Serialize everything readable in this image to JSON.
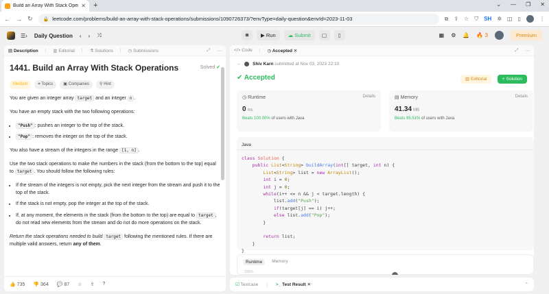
{
  "browser": {
    "tab_title": "Build an Array With Stack Opera",
    "url": "leetcode.com/problems/build-an-array-with-stack-operations/submissions/1090726373/?envType=daily-question&envId=2023-11-03",
    "profile": "SH"
  },
  "nav": {
    "daily": "Daily Question",
    "run": "Run",
    "submit": "Submit",
    "streak": "3",
    "premium": "Premium"
  },
  "left": {
    "tabs": [
      "Description",
      "Editorial",
      "Solutions",
      "Submissions"
    ],
    "title": "1441. Build an Array With Stack Operations",
    "solved": "Solved",
    "chips": [
      "Medium",
      "Topics",
      "Companies",
      "Hint"
    ],
    "p1_a": "You are given an integer array ",
    "p1_code1": "target",
    "p1_b": " and an integer ",
    "p1_code2": "n",
    "p1_c": ".",
    "p2": "You have an empty stack with the two following operations:",
    "op1_code": "\"Push\"",
    "op1_text": ": pushes an integer to the top of the stack.",
    "op2_code": "\"Pop\"",
    "op2_text": ": removes the integer on the top of the stack.",
    "p3_a": "You also have a stream of the integers in the range ",
    "p3_code": "[1, n]",
    "p3_b": ".",
    "p4_a": "Use the two stack operations to make the numbers in the stack (from the bottom to the top) equal to ",
    "p4_code": "target",
    "p4_b": ". You should follow the following rules:",
    "rule1": "If the stream of the integers is not empty, pick the next integer from the stream and push it to the top of the stack.",
    "rule2": "If the stack is not empty, pop the integer at the top of the stack.",
    "rule3_a": "If, at any moment, the elements in the stack (from the bottom to the top) are equal to ",
    "rule3_code": "target",
    "rule3_b": ", do not read new elements from the stream and do not do more operations on the stack.",
    "p5_a": "Return the stack operations needed to build ",
    "p5_code": "target",
    "p5_b": " following the mentioned rules. If there are multiple valid answers, return ",
    "p5_bold": "any of them",
    "p5_c": ".",
    "likes": "735",
    "dislikes": "364",
    "comments": "87"
  },
  "right": {
    "tabs": [
      "Code",
      "Accepted"
    ],
    "author": "Shiv Karn",
    "submitted": "submitted at Nov 03, 2023 22:10",
    "status": "Accepted",
    "editorial": "Editorial",
    "solution": "+ Solution",
    "runtime": {
      "label": "Runtime",
      "details": "Details",
      "value": "0",
      "unit": "ms",
      "beats_pct": "Beats 100.00%",
      "beats_rest": " of users with Java"
    },
    "memory": {
      "label": "Memory",
      "details": "Details",
      "value": "41.34",
      "unit": "MB",
      "beats_pct": "Beats 95.51%",
      "beats_rest": " of users with Java"
    },
    "language": "Java",
    "chart_tabs": [
      "Runtime",
      "Memory"
    ],
    "chart_pct": "100%"
  },
  "bottom": {
    "testcase": "Testcase",
    "result": "Test Result"
  }
}
